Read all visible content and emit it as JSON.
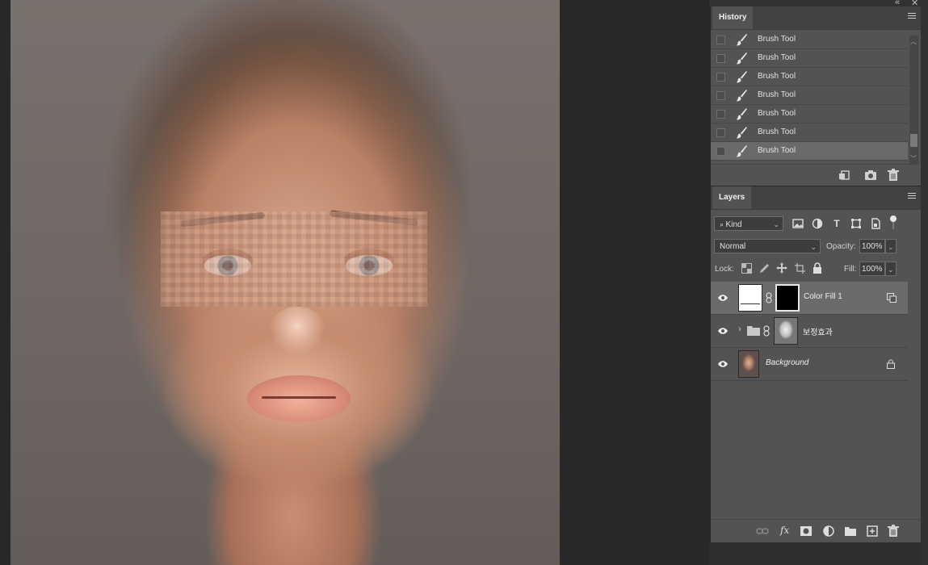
{
  "window": {
    "collapse_glyph": "«",
    "close_glyph": "✕"
  },
  "history": {
    "tab_label": "History",
    "items": [
      {
        "label": "Brush Tool",
        "icon": "brush-icon"
      },
      {
        "label": "Brush Tool",
        "icon": "brush-icon"
      },
      {
        "label": "Brush Tool",
        "icon": "brush-icon"
      },
      {
        "label": "Brush Tool",
        "icon": "brush-icon"
      },
      {
        "label": "Brush Tool",
        "icon": "brush-icon"
      },
      {
        "label": "Brush Tool",
        "icon": "brush-icon"
      },
      {
        "label": "Brush Tool",
        "icon": "brush-icon",
        "active": true
      }
    ],
    "footer_icons": [
      "new-document-from-state-icon",
      "snapshot-camera-icon",
      "trash-icon"
    ]
  },
  "layers": {
    "tab_label": "Layers",
    "filter": {
      "value": "Kind",
      "icons": [
        "image-filter-icon",
        "adjustment-filter-icon",
        "type-filter-icon",
        "shape-filter-icon",
        "smart-object-filter-icon"
      ]
    },
    "blend_mode": "Normal",
    "opacity_label": "Opacity:",
    "opacity_value": "100%",
    "lock_label": "Lock:",
    "fill_label": "Fill:",
    "fill_value": "100%",
    "items": [
      {
        "name": "Color Fill 1",
        "type": "fill",
        "selected": true
      },
      {
        "name": "보정효과",
        "type": "group"
      },
      {
        "name": "Background",
        "type": "background",
        "locked": true
      }
    ],
    "footer_icons": [
      "link-icon",
      "fx-icon",
      "mask-icon",
      "adjustment-icon",
      "folder-icon",
      "new-layer-icon",
      "trash-icon"
    ],
    "fx_label": "fx"
  },
  "colors": {
    "panel_bg": "#535353",
    "tab_bar": "#424242",
    "selected_row": "#6b6b6b",
    "workspace": "#282828"
  }
}
